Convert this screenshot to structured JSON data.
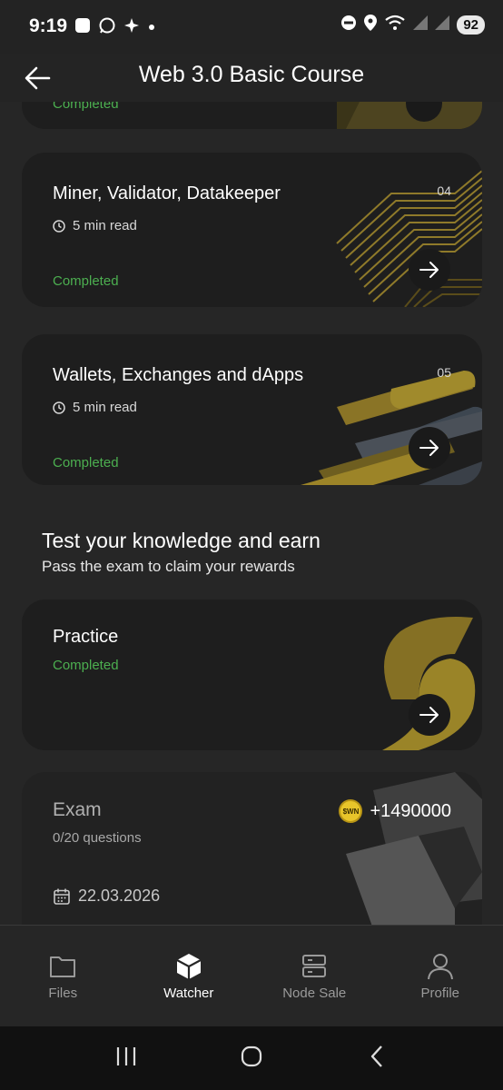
{
  "status_bar": {
    "time": "9:19",
    "battery": "92"
  },
  "header": {
    "title": "Web 3.0 Basic Course"
  },
  "lessons": [
    {
      "title": "",
      "read_time": "",
      "number": "",
      "status": "Completed"
    },
    {
      "title": "Miner, Validator, Datakeeper",
      "read_time": "5 min read",
      "number": "04",
      "status": "Completed"
    },
    {
      "title": "Wallets, Exchanges and dApps",
      "read_time": "5 min read",
      "number": "05",
      "status": "Completed"
    }
  ],
  "knowledge": {
    "title": "Test your knowledge and earn",
    "subtitle": "Pass the exam to claim your rewards"
  },
  "practice": {
    "title": "Practice",
    "status": "Completed"
  },
  "exam": {
    "title": "Exam",
    "questions": "0/20 questions",
    "reward": "+1490000",
    "coin_label": "$WN",
    "date": "22.03.2026"
  },
  "bottom_nav": {
    "items": [
      {
        "label": "Files",
        "icon": "folder-icon",
        "active": false
      },
      {
        "label": "Watcher",
        "icon": "cube-icon",
        "active": true
      },
      {
        "label": "Node Sale",
        "icon": "server-icon",
        "active": false
      },
      {
        "label": "Profile",
        "icon": "user-icon",
        "active": false
      }
    ]
  },
  "colors": {
    "background": "#262626",
    "card": "#1e1e1e",
    "completed": "#4caf50",
    "accent_gold": "#b8a030"
  }
}
